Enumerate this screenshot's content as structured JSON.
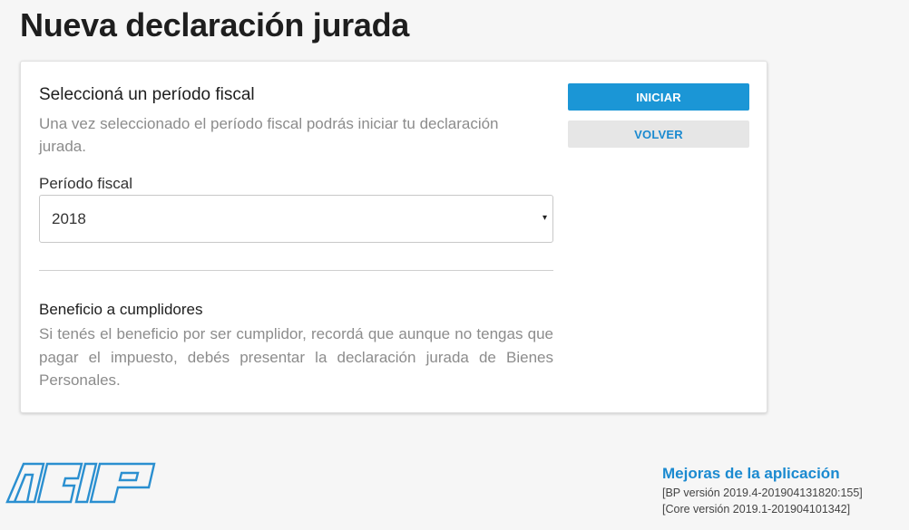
{
  "page": {
    "title": "Nueva declaración jurada"
  },
  "form": {
    "section_title": "Seleccioná un período fiscal",
    "section_description": "Una vez seleccionado el período fiscal podrás iniciar tu declaración jurada.",
    "period_label": "Período fiscal",
    "period_value": "2018",
    "caret": "▾"
  },
  "benefit": {
    "title": "Beneficio a cumplidores",
    "description": "Si tenés el beneficio por ser cumplidor, recordá que aunque no tengas que pagar el impuesto, debés presentar la declaración jurada de Bienes Personales."
  },
  "actions": {
    "start_label": "INICIAR",
    "back_label": "VOLVER"
  },
  "footer": {
    "logo_text": "AFIP",
    "improvements_link": "Mejoras de la aplicación",
    "bp_version": "[BP versión 2019.4-201904131820:155]",
    "core_version": "[Core versión 2019.1-201904101342]"
  },
  "colors": {
    "primary": "#1b96d6",
    "link": "#1b8ad0",
    "logo": "#2a8fd0",
    "background": "#f6f6f6"
  }
}
